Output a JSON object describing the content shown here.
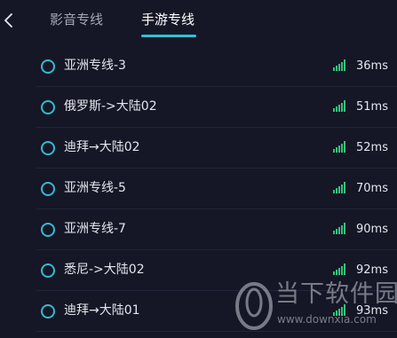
{
  "header": {
    "back_icon": "chevron-left-icon",
    "tabs": [
      {
        "label": "影音专线",
        "active": false
      },
      {
        "label": "手游专线",
        "active": true
      }
    ]
  },
  "colors": {
    "background": "#151726",
    "accent": "#2ec3d9",
    "signal": "#34c37a",
    "radio": "#38b9cf"
  },
  "servers": [
    {
      "name": "亚洲专线-3",
      "latency": "36ms",
      "signal_bars": 5
    },
    {
      "name": "俄罗斯->大陆02",
      "latency": "51ms",
      "signal_bars": 5
    },
    {
      "name": "迪拜→大陆02",
      "latency": "52ms",
      "signal_bars": 5
    },
    {
      "name": "亚洲专线-5",
      "latency": "70ms",
      "signal_bars": 5
    },
    {
      "name": "亚洲专线-7",
      "latency": "90ms",
      "signal_bars": 5
    },
    {
      "name": "悉尼->大陆02",
      "latency": "92ms",
      "signal_bars": 5
    },
    {
      "name": "迪拜→大陆01",
      "latency": "93ms",
      "signal_bars": 5
    }
  ],
  "watermark": {
    "name": "当下软件园",
    "url": "www.downxia.com"
  }
}
